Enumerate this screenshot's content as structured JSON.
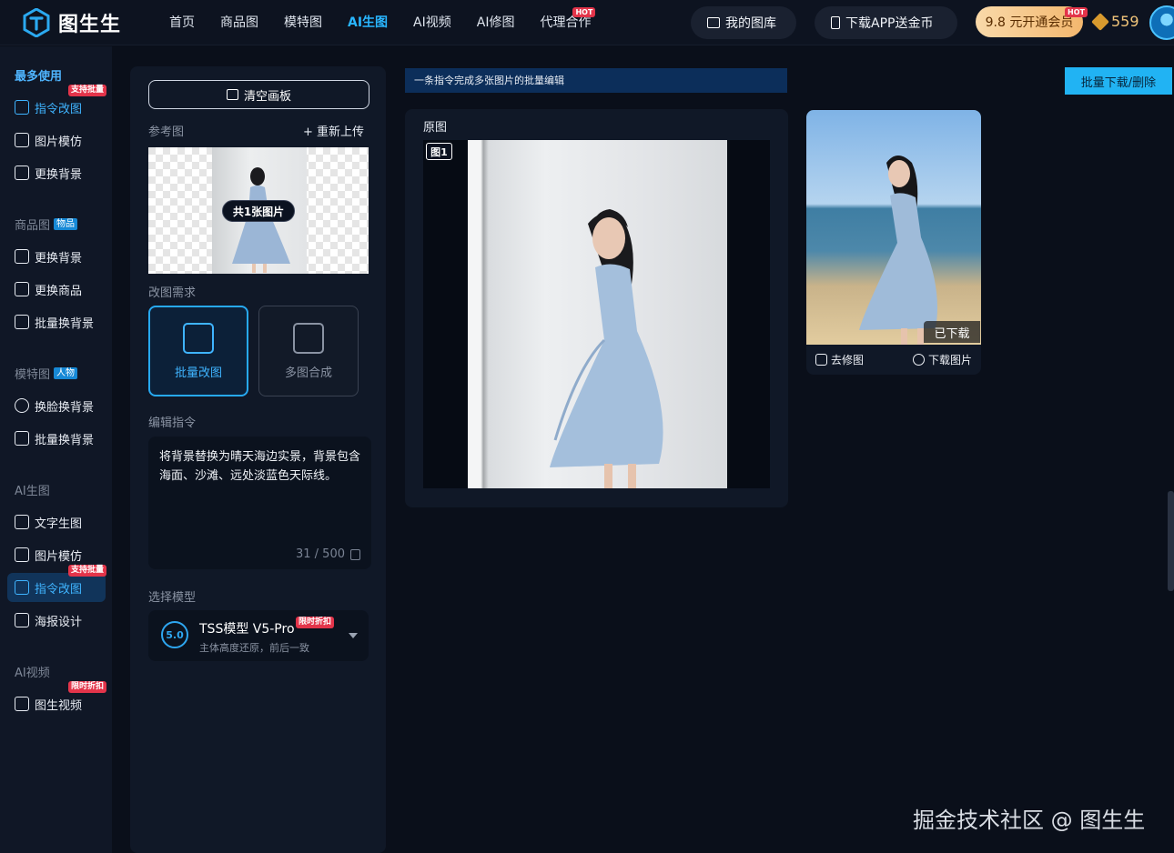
{
  "header": {
    "brand": "图生生",
    "nav": [
      "首页",
      "商品图",
      "模特图",
      "AI生图",
      "AI视频",
      "AI修图",
      "代理合作"
    ],
    "nav_hot": "HOT",
    "my_gallery": "我的图库",
    "download_app": "下载APP送金币",
    "vip": "9.8 元开通会员",
    "vip_hot": "HOT",
    "coins": "559"
  },
  "sidebar": {
    "groups": [
      {
        "title": "最多使用",
        "tag": ""
      },
      {
        "title": "商品图",
        "tag": "物品"
      },
      {
        "title": "模特图",
        "tag": "人物"
      },
      {
        "title": "AI生图",
        "tag": ""
      },
      {
        "title": "AI视频",
        "tag": ""
      }
    ],
    "items": [
      {
        "label": "指令改图",
        "badge": "支持批量"
      },
      {
        "label": "图片模仿",
        "badge": ""
      },
      {
        "label": "更换背景",
        "badge": ""
      },
      {
        "label": "更换背景",
        "badge": ""
      },
      {
        "label": "更换商品",
        "badge": ""
      },
      {
        "label": "批量换背景",
        "badge": ""
      },
      {
        "label": "换脸换背景",
        "badge": ""
      },
      {
        "label": "批量换背景",
        "badge": ""
      },
      {
        "label": "文字生图",
        "badge": ""
      },
      {
        "label": "图片模仿",
        "badge": ""
      },
      {
        "label": "指令改图",
        "badge": "支持批量"
      },
      {
        "label": "海报设计",
        "badge": ""
      },
      {
        "label": "图生视频",
        "badge": "限时折扣"
      }
    ]
  },
  "panel": {
    "clear": "清空画板",
    "ref_label": "参考图",
    "reupload": "+ 重新上传",
    "count": "共1张图片",
    "edit_need": "改图需求",
    "mode_batch": "批量改图",
    "mode_multi": "多图合成",
    "instr_label": "编辑指令",
    "instruction": "将背景替换为晴天海边实景，背景包含海面、沙滩、远处淡蓝色天际线。",
    "counter": "31 / 500",
    "model_label": "选择模型",
    "model_name": "TSS模型 V5-Pro",
    "model_badge": "限时折扣",
    "model_icon": "5.0",
    "model_desc": "主体高度还原，前后一致"
  },
  "main": {
    "banner": "一条指令完成多张图片的批量编辑",
    "batch_btn": "批量下载/删除",
    "orig_title": "原图",
    "fig_label": "图1",
    "downloaded": "已下载",
    "retouch": "去修图",
    "download_img": "下载图片"
  },
  "watermark": "掘金技术社区 @ 图生生"
}
